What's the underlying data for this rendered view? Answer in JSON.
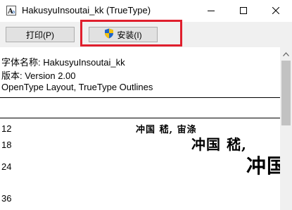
{
  "window": {
    "title": "HakusyuInsoutai_kk (TrueType)",
    "icon": "font-file-icon",
    "controls": {
      "minimize": "minimize-icon",
      "maximize": "maximize-icon",
      "close": "close-icon"
    }
  },
  "toolbar": {
    "print_label": "打印(P)",
    "install_label": "安装(I)",
    "install_icon": "uac-shield-icon",
    "highlight_color": "#e01f2d"
  },
  "font_info": {
    "name_line": "字体名称: HakusyuInsoutai_kk",
    "version_line": "版本: Version 2.00",
    "outline_line": "OpenType Layout, TrueType Outlines"
  },
  "samples": [
    {
      "size": "12",
      "text": "冲国 嵇, 宙涤"
    },
    {
      "size": "18",
      "text": "冲国 嵇,"
    },
    {
      "size": "24",
      "text": "冲国"
    },
    {
      "size": "36",
      "text": ""
    }
  ]
}
